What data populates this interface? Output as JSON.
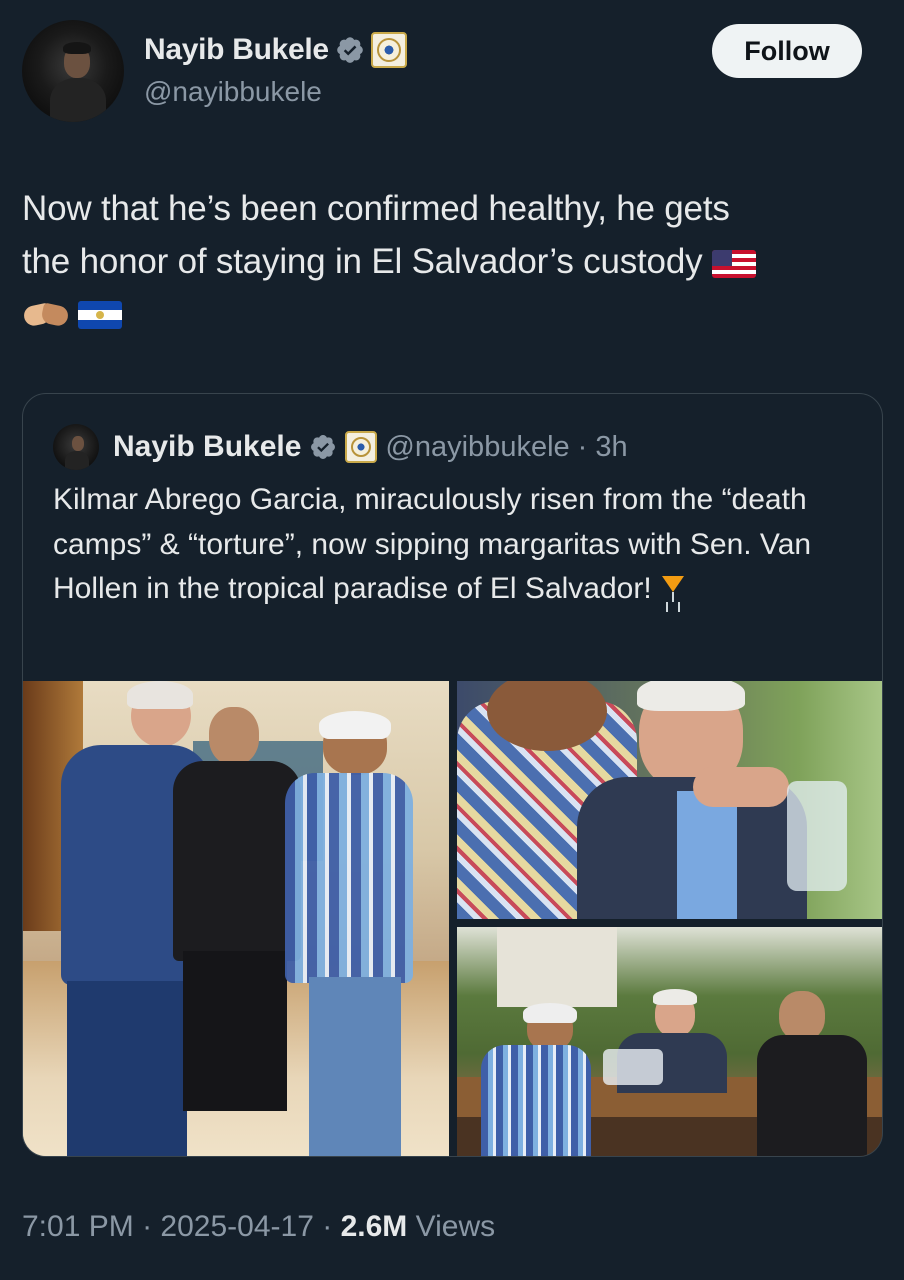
{
  "tweet": {
    "author": {
      "display_name": "Nayib Bukele",
      "handle": "@nayibbukele"
    },
    "follow_label": "Follow",
    "text_line1": "Now that he’s been confirmed healthy, he gets",
    "text_line2": "the honor of staying in El Salvador’s custody",
    "emoji_line2": [
      "flag-united-states"
    ],
    "emoji_line3": [
      "handshake",
      "flag-el-salvador"
    ],
    "timestamp": "7:01 PM",
    "date": "2025-04-17",
    "views_count": "2.6M",
    "views_label": "Views",
    "separator": "·"
  },
  "quote": {
    "display_name": "Nayib Bukele",
    "handle": "@nayibbukele",
    "time_ago": "3h",
    "separator": "·",
    "text": "Kilmar Abrego Garcia, miraculously risen from the “death camps” & “torture”, now sipping margaritas with Sen. Van Hollen in the tropical paradise of El Salvador!",
    "emoji": "tropical-drink",
    "media": [
      {
        "name": "photo-handshake-hotel-lobby"
      },
      {
        "name": "photo-senator-closeup"
      },
      {
        "name": "photo-restaurant-table"
      }
    ]
  },
  "colors": {
    "background": "#15202b",
    "text_primary": "#e7e9ea",
    "text_secondary": "#8b98a5",
    "border": "#38444d",
    "verified_badge": "#8b98a5",
    "follow_bg": "#eff3f4"
  },
  "icons": {
    "verified": "verified-badge-icon",
    "affiliate": "el-salvador-seal-icon"
  }
}
